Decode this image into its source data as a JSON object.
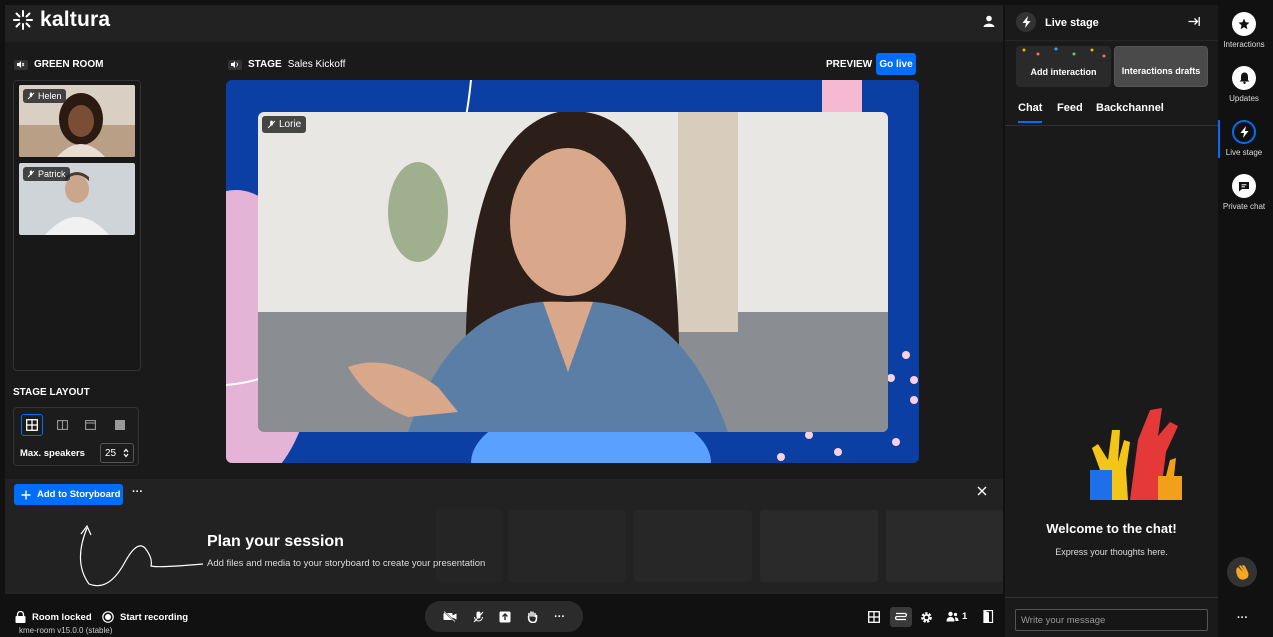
{
  "header": {
    "logo_text": "kaltura"
  },
  "green_room": {
    "label": "GREEN ROOM",
    "participants": [
      {
        "name": "Helen"
      },
      {
        "name": "Patrick"
      }
    ]
  },
  "stage": {
    "label": "STAGE",
    "title": "Sales Kickoff",
    "preview_label": "PREVIEW",
    "go_live_label": "Go live",
    "speaker_name": "Lorie"
  },
  "stage_layout": {
    "label": "STAGE LAYOUT",
    "max_speakers_label": "Max. speakers",
    "max_speakers_value": "25"
  },
  "storyboard": {
    "add_label": "Add to Storyboard",
    "more_label": "···",
    "plan_title": "Plan your session",
    "plan_subtitle": "Add files and media to your storyboard to create your presentation"
  },
  "bottom_bar": {
    "room_locked_label": "Room locked",
    "start_recording_label": "Start recording",
    "version": "kme-room v15.0.0 (stable)",
    "participant_count": "1",
    "more_label": "···"
  },
  "right_panel": {
    "title": "Live stage",
    "add_interaction_label": "Add interaction",
    "drafts_label": "Interactions drafts",
    "tabs": [
      "Chat",
      "Feed",
      "Backchannel"
    ],
    "active_tab": "Chat",
    "welcome_title": "Welcome to the chat!",
    "welcome_subtitle": "Express your thoughts here.",
    "input_placeholder": "Write your message"
  },
  "rail": {
    "items": [
      {
        "label": "Interactions",
        "icon": "star-icon"
      },
      {
        "label": "Updates",
        "icon": "bell-icon"
      },
      {
        "label": "Live stage",
        "icon": "bolt-icon"
      },
      {
        "label": "Private chat",
        "icon": "chat-icon"
      }
    ],
    "more_label": "···"
  },
  "colors": {
    "accent": "#006efa",
    "background": "#1a1a1a",
    "stage_bg": "#0b3fa3"
  }
}
